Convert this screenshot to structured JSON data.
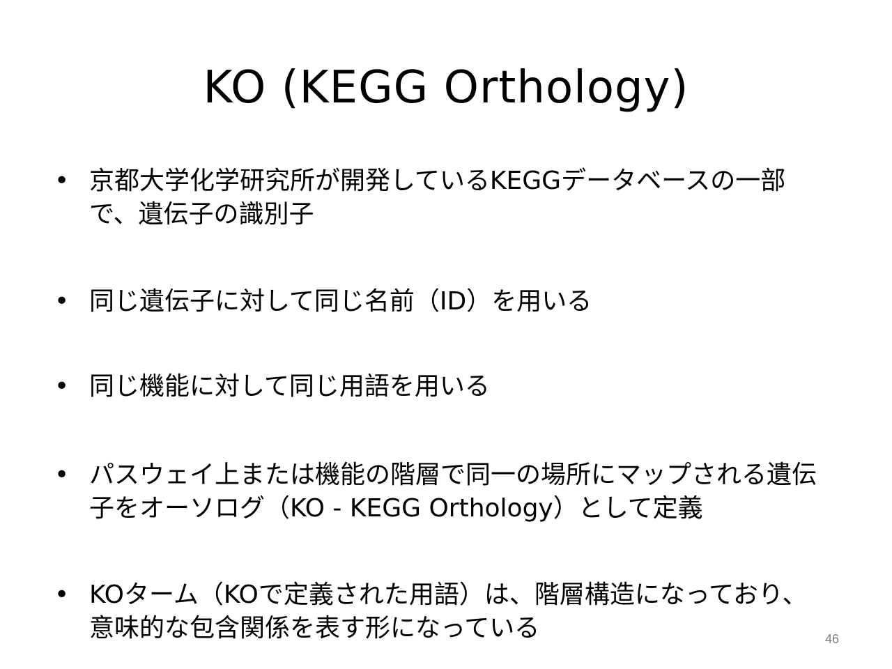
{
  "slide": {
    "title": "KO (KEGG Orthology)",
    "bullet_symbol": "•",
    "bullets": [
      "京都大学化学研究所が開発しているKEGGデータベースの一部で、遺伝子の識別子",
      "同じ遺伝子に対して同じ名前（ID）を用いる",
      "同じ機能に対して同じ用語を用いる",
      "パスウェイ上または機能の階層で同一の場所にマップされる遺伝子をオーソログ（KO - KEGG Orthology）として定義",
      "KOターム（KOで定義された用語）は、階層構造になっており、意味的な包含関係を表す形になっている"
    ],
    "page_number": "46"
  },
  "colors": {
    "background": "#ffffff",
    "text": "#000000",
    "page_number": "#7f7f7f"
  }
}
